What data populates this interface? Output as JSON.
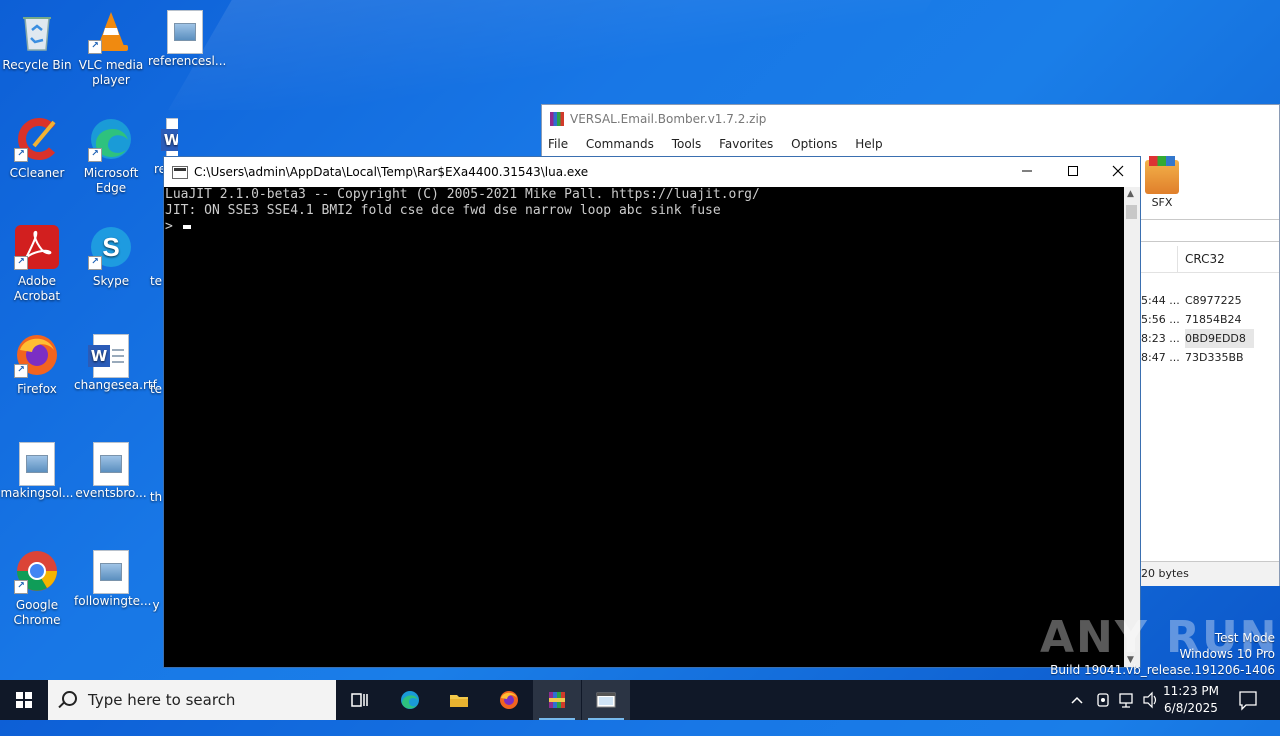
{
  "desktop": {
    "icons": [
      {
        "label": "Recycle Bin"
      },
      {
        "label": "VLC media player"
      },
      {
        "label": "referencesl..."
      },
      {
        "label": "CCleaner"
      },
      {
        "label": "Microsoft Edge"
      },
      {
        "label": "re"
      },
      {
        "label": "Adobe Acrobat"
      },
      {
        "label": "Skype"
      },
      {
        "label": "te"
      },
      {
        "label": "Firefox"
      },
      {
        "label": "changesea.rtf"
      },
      {
        "label": "te"
      },
      {
        "label": "makingsol..."
      },
      {
        "label": "eventsbro..."
      },
      {
        "label": "th"
      },
      {
        "label": "Google Chrome"
      },
      {
        "label": "followingte..."
      },
      {
        "label": "y"
      }
    ]
  },
  "winrar": {
    "title": "VERSAL.Email.Bomber.v1.7.2.zip",
    "menu": [
      "File",
      "Commands",
      "Tools",
      "Favorites",
      "Options",
      "Help"
    ],
    "sfx_label": "SFX",
    "column_crc": "CRC32",
    "rows": [
      {
        "time": "5:44 ...",
        "crc": "C8977225"
      },
      {
        "time": "5:56 ...",
        "crc": "71854B24"
      },
      {
        "time": "8:23 ...",
        "crc": "0BD9EDD8"
      },
      {
        "time": "8:47 ...",
        "crc": "73D335BB"
      }
    ],
    "status": "20 bytes"
  },
  "console": {
    "title": "C:\\Users\\admin\\AppData\\Local\\Temp\\Rar$EXa4400.31543\\lua.exe",
    "lines": [
      "LuaJIT 2.1.0-beta3 -- Copyright (C) 2005-2021 Mike Pall. https://luajit.org/",
      "JIT: ON SSE3 SSE4.1 BMI2 fold cse dce fwd dse narrow loop abc sink fuse"
    ],
    "prompt": ">"
  },
  "watermark": "ANY RUN",
  "test_mode": {
    "line1": "Test Mode",
    "line2": "Windows 10 Pro",
    "line3": "Build 19041.vb_release.191206-1406"
  },
  "taskbar": {
    "search_placeholder": "Type here to search",
    "time": "11:23 PM",
    "date": "6/8/2025"
  }
}
